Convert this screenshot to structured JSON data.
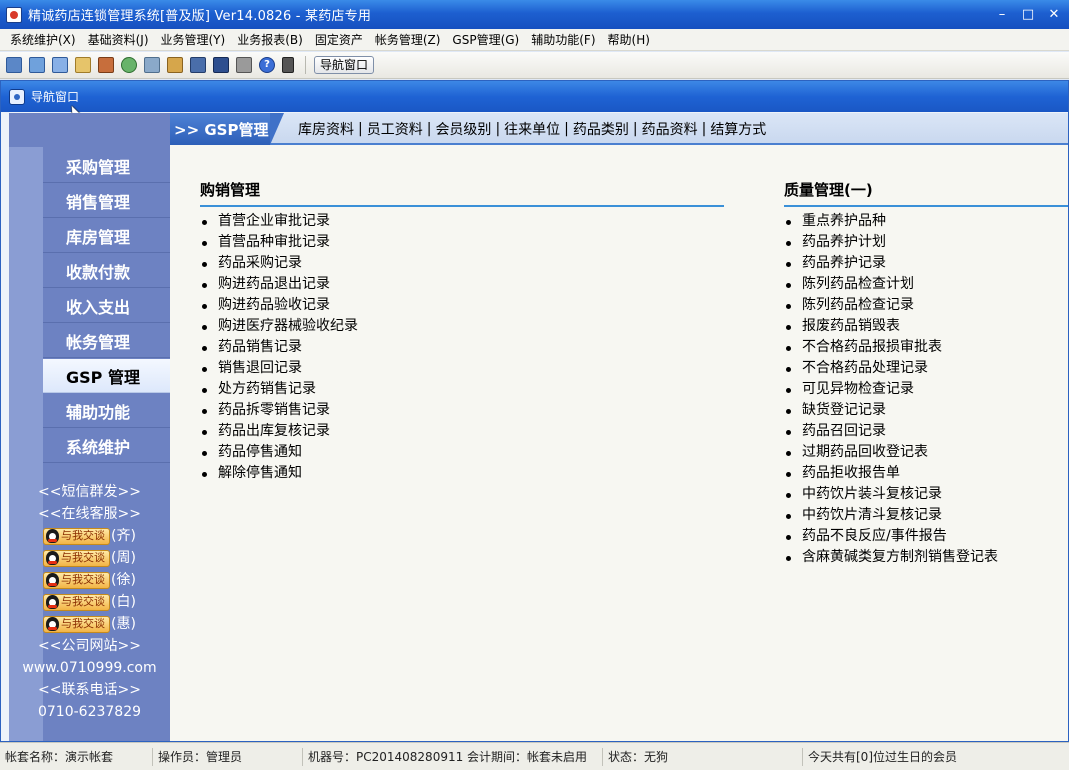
{
  "window": {
    "title": "精诚药店连锁管理系统[普及版] Ver14.0826 - 某药店专用",
    "minimize": "–",
    "restore": "□",
    "close": "✕"
  },
  "menu": [
    "系统维护(X)",
    "基础资料(J)",
    "业务管理(Y)",
    "业务报表(B)",
    "固定资产",
    "帐务管理(Z)",
    "GSP管理(G)",
    "辅助功能(F)",
    "帮助(H)"
  ],
  "toolbar": {
    "icons": [
      "grid-icon",
      "form-icon",
      "windows-icon",
      "edit-icon",
      "report-icon",
      "tools-icon",
      "users-icon",
      "print-preview-icon",
      "export-icon",
      "image-icon",
      "save-icon",
      "printer-icon",
      "help-icon",
      "exit-icon"
    ],
    "help_glyph": "?",
    "nav_button": "导航窗口"
  },
  "nav_window": {
    "title": "导航窗口"
  },
  "sidebar": {
    "items": [
      "采购管理",
      "销售管理",
      "库房管理",
      "收款付款",
      "收入支出",
      "帐务管理",
      "GSP 管理",
      "辅助功能",
      "系统维护"
    ],
    "active_index": 6,
    "sms": "<<短信群发>>",
    "online_service": "<<在线客服>>",
    "chat_label": "与我交谈",
    "agents": [
      "(齐)",
      "(周)",
      "(徐)",
      "(白)",
      "(惠)"
    ],
    "website_label": "<<公司网站>>",
    "website": "www.0710999.com",
    "phone_label": "<<联系电话>>",
    "phone": "0710-6237829"
  },
  "content": {
    "section": ">> GSP管理",
    "tabs": [
      "库房资料",
      "员工资料",
      "会员级别",
      "往来单位",
      "药品类别",
      "药品资料",
      "结算方式"
    ],
    "tab_sep": "|",
    "col1": {
      "title": "购销管理",
      "items": [
        "首营企业审批记录",
        "首营品种审批记录",
        "药品采购记录",
        "购进药品退出记录",
        "购进药品验收记录",
        "购进医疗器械验收纪录",
        "药品销售记录",
        "销售退回记录",
        "处方药销售记录",
        "药品拆零销售记录",
        "药品出库复核记录",
        "药品停售通知",
        "解除停售通知"
      ]
    },
    "col2": {
      "title": "质量管理(一)",
      "items": [
        "重点养护品种",
        "药品养护计划",
        "药品养护记录",
        "陈列药品检查计划",
        "陈列药品检查记录",
        "报废药品销毁表",
        "不合格药品报损审批表",
        "不合格药品处理记录",
        "可见异物检查记录",
        "缺货登记记录",
        "药品召回记录",
        "过期药品回收登记表",
        "药品拒收报告单",
        "中药饮片装斗复核记录",
        "中药饮片清斗复核记录",
        "药品不良反应/事件报告",
        "含麻黄碱类复方制剂销售登记表"
      ]
    }
  },
  "status": {
    "account": "帐套名称：演示帐套",
    "operator": "操作员：管理员",
    "machine": "机器号：PC201408280911 会计期间：帐套未启用",
    "state": "状态：无狗",
    "members": "今天共有[0]位过生日的会员"
  }
}
